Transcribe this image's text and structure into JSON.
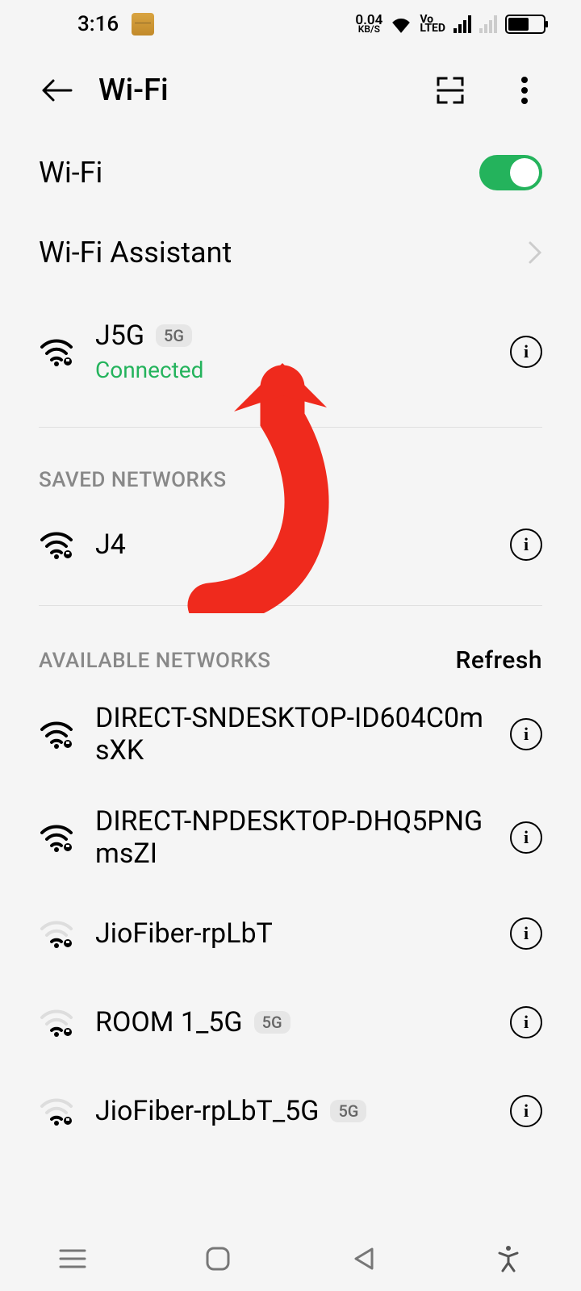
{
  "status": {
    "time": "3:16",
    "kbps_value": "0.04",
    "kbps_unit": "KB/S",
    "volte_top": "Vo",
    "volte_bot": "LTED"
  },
  "appbar": {
    "title": "Wi-Fi"
  },
  "wifi_toggle": {
    "label": "Wi-Fi",
    "on": true
  },
  "assistant": {
    "label": "Wi-Fi Assistant"
  },
  "connected": {
    "name": "J5G",
    "badge": "5G",
    "status": "Connected"
  },
  "saved_section": {
    "header": "SAVED NETWORKS"
  },
  "saved": [
    {
      "name": "J4"
    }
  ],
  "available_section": {
    "header": "AVAILABLE NETWORKS",
    "action": "Refresh"
  },
  "available": [
    {
      "name": "DIRECT-SNDESKTOP-ID604C0msXK",
      "strength": "strong",
      "badge": ""
    },
    {
      "name": "DIRECT-NPDESKTOP-DHQ5PNGmsZI",
      "strength": "strong",
      "badge": ""
    },
    {
      "name": "JioFiber-rpLbT",
      "strength": "weak",
      "badge": ""
    },
    {
      "name": "ROOM 1_5G",
      "strength": "weak",
      "badge": "5G"
    },
    {
      "name": "JioFiber-rpLbT_5G",
      "strength": "weak",
      "badge": "5G"
    }
  ],
  "info_glyph": "i"
}
